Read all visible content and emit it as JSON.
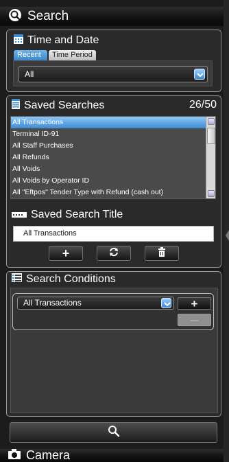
{
  "header": {
    "title": "Search"
  },
  "time_and_date": {
    "title": "Time and Date",
    "tabs": [
      {
        "label": "Recent",
        "active": true
      },
      {
        "label": "Time Period",
        "active": false
      }
    ],
    "selected": "All"
  },
  "saved_searches": {
    "title": "Saved Searches",
    "count": "26/50",
    "items": [
      "All Transactions",
      "Terminal ID-91",
      "All Staff Purchases",
      "All Refunds",
      "All Voids",
      "All Voids by Operator ID",
      "All \"Eftpos\" Tender Type with Refund (cash out)"
    ],
    "selected_index": 0
  },
  "saved_search_title": {
    "title": "Saved Search Title",
    "value": "All Transactions",
    "add_label": "+",
    "refresh_icon": "refresh-icon",
    "delete_icon": "trash-icon"
  },
  "search_conditions": {
    "title": "Search Conditions",
    "selected": "All Transactions",
    "add_label": "+",
    "remove_label": "—"
  },
  "search_button": {
    "icon": "magnifier-icon"
  },
  "camera": {
    "title": "Camera"
  },
  "colors": {
    "accent": "#3e8ad3",
    "selection": "#6cb3ea",
    "background": "#1c1c1c",
    "border": "#9a9a9a"
  }
}
